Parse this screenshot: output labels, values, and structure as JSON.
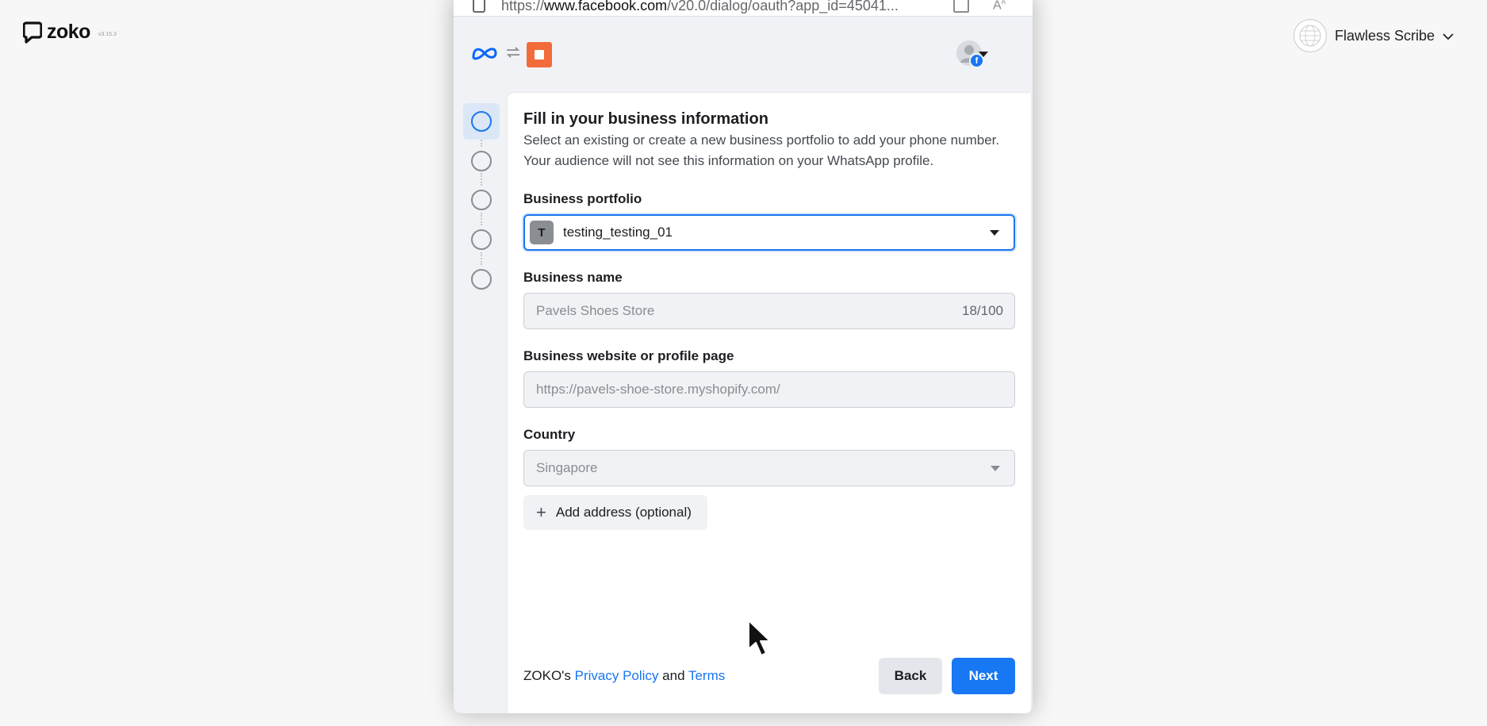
{
  "app": {
    "brand": "zoko",
    "version": "v3.15.3",
    "user_name": "Flawless Scribe"
  },
  "browser": {
    "url_prefix": "https://",
    "url_domain": "www.facebook.com",
    "url_path": "/v20.0/dialog/oauth?app_id=45041..."
  },
  "dialog": {
    "title": "Fill in your business information",
    "description": "Select an existing or create a new business portfolio to add your phone number. Your audience will not see this information on your WhatsApp profile.",
    "business_portfolio": {
      "label": "Business portfolio",
      "badge": "T",
      "value": "testing_testing_01"
    },
    "business_name": {
      "label": "Business name",
      "value": "Pavels Shoes Store",
      "count": "18/100"
    },
    "website": {
      "label": "Business website or profile page",
      "value": "https://pavels-shoe-store.myshopify.com/"
    },
    "country": {
      "label": "Country",
      "value": "Singapore"
    },
    "add_address_label": "Add address (optional)",
    "legal": {
      "prefix": "ZOKO's ",
      "privacy": "Privacy Policy",
      "and": " and ",
      "terms": "Terms"
    },
    "back_label": "Back",
    "next_label": "Next",
    "account_badge": "f"
  },
  "steps": {
    "total": 5,
    "active": 1
  },
  "colors": {
    "accent": "#1877f2",
    "app_icon": "#f26b3a",
    "meta_blue": "#0866ff"
  }
}
